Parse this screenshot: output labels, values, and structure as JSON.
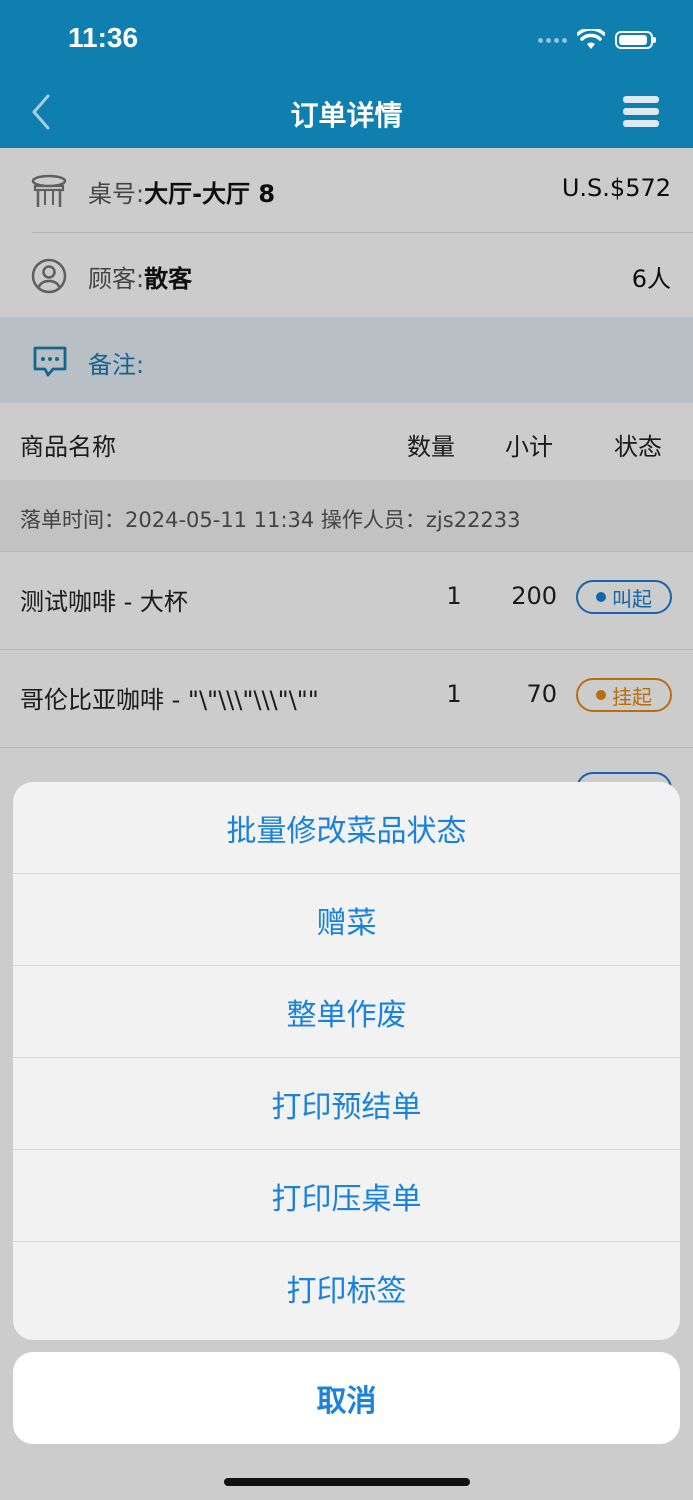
{
  "status_bar": {
    "time": "11:36"
  },
  "nav": {
    "title": "订单详情"
  },
  "order": {
    "table_label": "桌号:",
    "table_value": "大厅-大厅 8",
    "amount": "U.S.$572",
    "customer_label": "顾客:",
    "customer_value": "散客",
    "guests": "6人",
    "remark_label": "备注:"
  },
  "table_header": {
    "name": "商品名称",
    "qty": "数量",
    "subtotal": "小计",
    "status": "状态"
  },
  "order_time_line": "落单时间：2024-05-11 11:34 操作人员：zjs22233",
  "items": [
    {
      "name": "测试咖啡 - 大杯",
      "qty": "1",
      "subtotal": "200",
      "status": "叫起",
      "status_color": "#1a7fd8"
    },
    {
      "name": "哥伦比亚咖啡 - \"\\\"\\\\\\\"\\\\\\\"\\\"\"",
      "qty": "1",
      "subtotal": "70",
      "status": "挂起",
      "status_color": "#e88a12"
    }
  ],
  "action_sheet": {
    "options": [
      "批量修改菜品状态",
      "赠菜",
      "整单作废",
      "打印预结单",
      "打印压桌单",
      "打印标签"
    ],
    "cancel": "取消"
  },
  "colors": {
    "header": "#0f7fb0",
    "accent": "#1a82dc",
    "remark_bg": "#e6f1f7"
  }
}
